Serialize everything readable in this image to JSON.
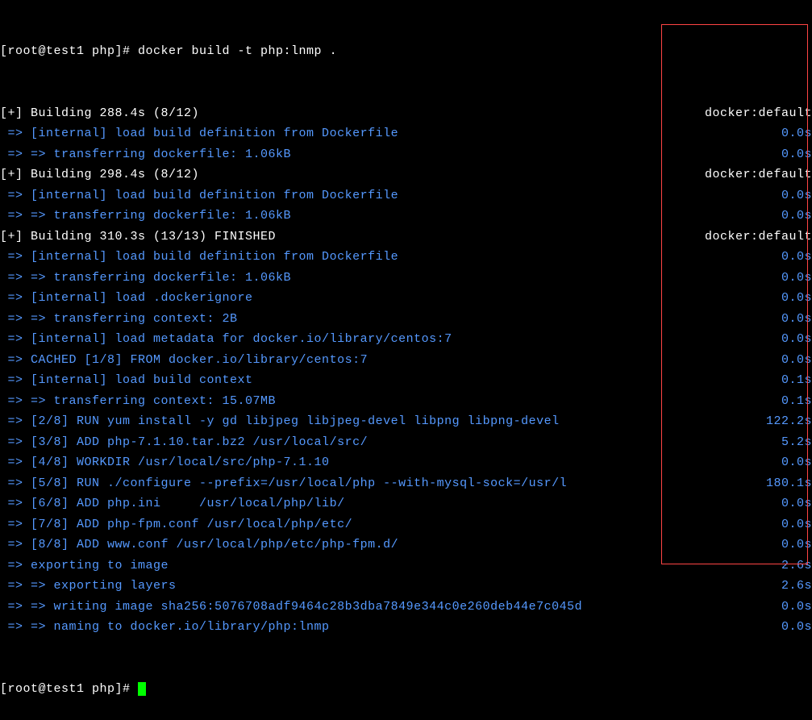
{
  "prompt1": "[root@test1 php]# docker build -t php:lnmp .",
  "prompt2": "[root@test1 php]# ",
  "lines": [
    {
      "l": "[+] Building 288.4s (8/12)",
      "r": "docker:default",
      "cl": "white",
      "cr": "white"
    },
    {
      "l": " => [internal] load build definition from Dockerfile",
      "r": "0.0s",
      "cl": "blue",
      "cr": "blue"
    },
    {
      "l": " => => transferring dockerfile: 1.06kB",
      "r": "0.0s",
      "cl": "blue",
      "cr": "blue"
    },
    {
      "l": "[+] Building 298.4s (8/12)",
      "r": "docker:default",
      "cl": "white",
      "cr": "white"
    },
    {
      "l": " => [internal] load build definition from Dockerfile",
      "r": "0.0s",
      "cl": "blue",
      "cr": "blue"
    },
    {
      "l": " => => transferring dockerfile: 1.06kB",
      "r": "0.0s",
      "cl": "blue",
      "cr": "blue"
    },
    {
      "l": "[+] Building 310.3s (13/13) FINISHED",
      "r": "docker:default",
      "cl": "white",
      "cr": "white"
    },
    {
      "l": " => [internal] load build definition from Dockerfile",
      "r": "0.0s",
      "cl": "blue",
      "cr": "blue"
    },
    {
      "l": " => => transferring dockerfile: 1.06kB",
      "r": "0.0s",
      "cl": "blue",
      "cr": "blue"
    },
    {
      "l": " => [internal] load .dockerignore",
      "r": "0.0s",
      "cl": "blue",
      "cr": "blue"
    },
    {
      "l": " => => transferring context: 2B",
      "r": "0.0s",
      "cl": "blue",
      "cr": "blue"
    },
    {
      "l": " => [internal] load metadata for docker.io/library/centos:7",
      "r": "0.0s",
      "cl": "blue",
      "cr": "blue"
    },
    {
      "l": " => CACHED [1/8] FROM docker.io/library/centos:7",
      "r": "0.0s",
      "cl": "blue",
      "cr": "blue"
    },
    {
      "l": " => [internal] load build context",
      "r": "0.1s",
      "cl": "blue",
      "cr": "blue"
    },
    {
      "l": " => => transferring context: 15.07MB",
      "r": "0.1s",
      "cl": "blue",
      "cr": "blue"
    },
    {
      "l": " => [2/8] RUN yum install -y gd libjpeg libjpeg-devel libpng libpng-devel",
      "r": "122.2s",
      "cl": "blue",
      "cr": "blue"
    },
    {
      "l": " => [3/8] ADD php-7.1.10.tar.bz2 /usr/local/src/",
      "r": "5.2s",
      "cl": "blue",
      "cr": "blue"
    },
    {
      "l": " => [4/8] WORKDIR /usr/local/src/php-7.1.10",
      "r": "0.0s",
      "cl": "blue",
      "cr": "blue"
    },
    {
      "l": " => [5/8] RUN ./configure --prefix=/usr/local/php --with-mysql-sock=/usr/l",
      "r": "180.1s",
      "cl": "blue",
      "cr": "blue"
    },
    {
      "l": " => [6/8] ADD php.ini     /usr/local/php/lib/",
      "r": "0.0s",
      "cl": "blue",
      "cr": "blue"
    },
    {
      "l": " => [7/8] ADD php-fpm.conf /usr/local/php/etc/",
      "r": "0.0s",
      "cl": "blue",
      "cr": "blue"
    },
    {
      "l": " => [8/8] ADD www.conf /usr/local/php/etc/php-fpm.d/",
      "r": "0.0s",
      "cl": "blue",
      "cr": "blue"
    },
    {
      "l": " => exporting to image",
      "r": "2.6s",
      "cl": "blue",
      "cr": "blue"
    },
    {
      "l": " => => exporting layers",
      "r": "2.6s",
      "cl": "blue",
      "cr": "blue"
    },
    {
      "l": " => => writing image sha256:5076708adf9464c28b3dba7849e344c0e260deb44e7c045d",
      "r": "0.0s",
      "cl": "blue",
      "cr": "blue"
    },
    {
      "l": " => => naming to docker.io/library/php:lnmp",
      "r": "0.0s",
      "cl": "blue",
      "cr": "blue"
    }
  ]
}
